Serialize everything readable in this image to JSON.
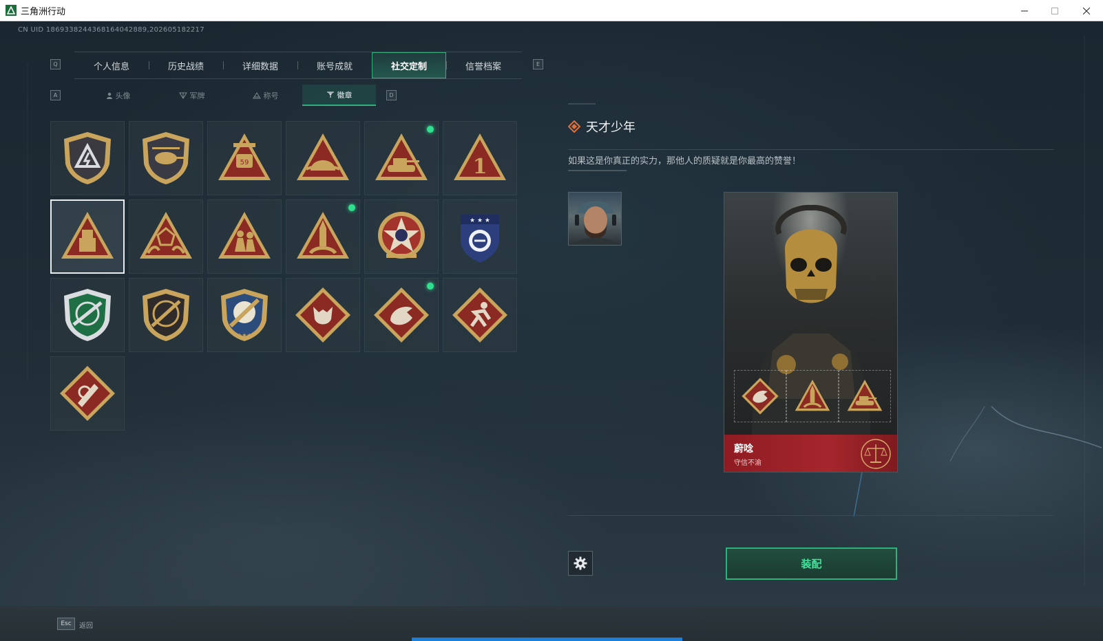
{
  "window": {
    "title": "三角洲行动"
  },
  "uid": "CN UID 1869338244368164042889,202605182217",
  "main_tabs": [
    {
      "label": "个人信息",
      "active": false
    },
    {
      "label": "历史战绩",
      "active": false
    },
    {
      "label": "详细数据",
      "active": false
    },
    {
      "label": "账号成就",
      "active": false
    },
    {
      "label": "社交定制",
      "active": true
    },
    {
      "label": "信誉档案",
      "active": false
    }
  ],
  "key_hints": {
    "prev_main": "Q",
    "next_main": "E",
    "prev_sub": "A",
    "next_sub": "D"
  },
  "sub_tabs": [
    {
      "label": "头像",
      "icon": "person-icon",
      "active": false
    },
    {
      "label": "军牌",
      "icon": "dogtag-icon",
      "active": false
    },
    {
      "label": "称号",
      "icon": "title-icon",
      "active": false
    },
    {
      "label": "徽章",
      "icon": "badge-icon",
      "active": true
    }
  ],
  "badges": [
    {
      "name": "lightning-shield-badge",
      "new": false,
      "selected": false
    },
    {
      "name": "helicopter-badge",
      "new": false,
      "selected": false
    },
    {
      "name": "vehicle-59-badge",
      "new": false,
      "selected": false
    },
    {
      "name": "helmet-triangle-badge",
      "new": false,
      "selected": false
    },
    {
      "name": "tank-badge",
      "new": true,
      "selected": false
    },
    {
      "name": "number-one-badge",
      "new": false,
      "selected": false
    },
    {
      "name": "usb-triangle-badge",
      "new": false,
      "selected": true
    },
    {
      "name": "hands-dice-badge",
      "new": false,
      "selected": false
    },
    {
      "name": "soldiers-badge",
      "new": false,
      "selected": false
    },
    {
      "name": "rocket-badge",
      "new": true,
      "selected": false
    },
    {
      "name": "star-compass-badge",
      "new": false,
      "selected": false
    },
    {
      "name": "blue-emblem-badge",
      "new": false,
      "selected": false
    },
    {
      "name": "green-rifle-badge",
      "new": false,
      "selected": false
    },
    {
      "name": "rifle-shield-badge",
      "new": false,
      "selected": false
    },
    {
      "name": "sniper-crest-badge",
      "new": false,
      "selected": false
    },
    {
      "name": "wolf-diamond-badge",
      "new": false,
      "selected": false
    },
    {
      "name": "dragon-diamond-badge",
      "new": true,
      "selected": false
    },
    {
      "name": "runner-diamond-badge",
      "new": false,
      "selected": false
    },
    {
      "name": "missile-diamond-badge",
      "new": false,
      "selected": false
    }
  ],
  "detail": {
    "title": "天才少年",
    "description": "如果这是你真正的实力，那他人的质疑就是你最高的赞誉！"
  },
  "card": {
    "name": "蔚唸",
    "subtitle": "守信不渝",
    "slots": [
      "dragon-diamond-badge",
      "rocket-badge",
      "tank-badge"
    ]
  },
  "actions": {
    "equip_label": "装配"
  },
  "footer": {
    "esc_key": "Esc",
    "esc_label": "返回"
  },
  "colors": {
    "accent": "#2fb07c",
    "badge_gold": "#c9a45c",
    "badge_red": "#8b2a22",
    "card_red": "#a5262c",
    "new_dot": "#2fe08f"
  }
}
